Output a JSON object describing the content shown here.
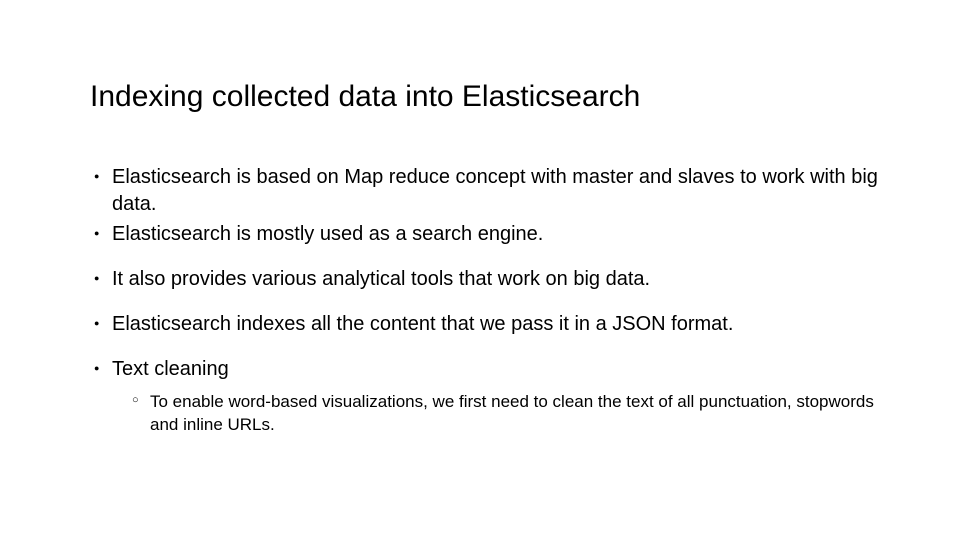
{
  "slide": {
    "title": "Indexing collected data into Elasticsearch",
    "bullets": {
      "b0": "Elasticsearch is based on Map reduce concept with master and slaves to work with big data.",
      "b1": "Elasticsearch is mostly used as a search engine.",
      "b2": "It also provides various analytical tools that work on big data.",
      "b3": "Elasticsearch indexes all the content that we pass it in a JSON format.",
      "b4": "Text cleaning"
    },
    "subbullets": {
      "s0": "To enable word-based visualizations, we first need to clean the text of all punctuation, stopwords and inline URLs."
    }
  }
}
